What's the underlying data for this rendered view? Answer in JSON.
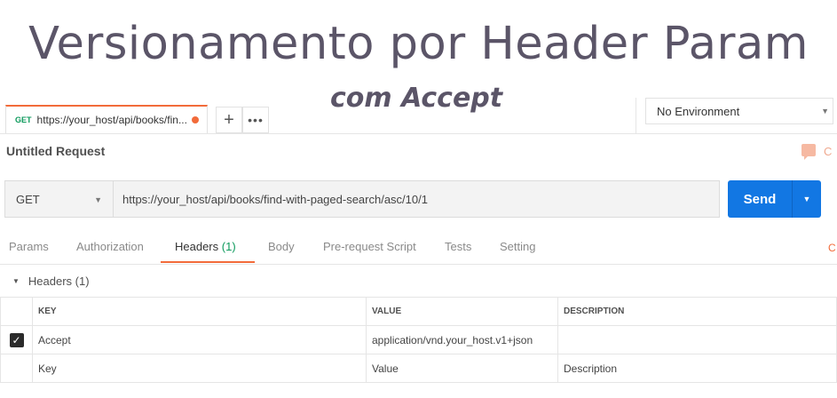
{
  "slide": {
    "title": "Versionamento por Header Param",
    "subtitle": "com Accept"
  },
  "tabbar": {
    "tab": {
      "method": "GET",
      "url": "https://your_host/api/books/fin..."
    },
    "add_label": "+",
    "more_label": "•••"
  },
  "environment": {
    "selected": "No Environment"
  },
  "request": {
    "title": "Untitled Request",
    "comments_label": "C",
    "method": "GET",
    "url": "https://your_host/api/books/find-with-paged-search/asc/10/1",
    "send_label": "Send"
  },
  "subtabs": {
    "params": "Params",
    "authorization": "Authorization",
    "headers": "Headers",
    "headers_count": "(1)",
    "body": "Body",
    "prerequest": "Pre-request Script",
    "tests": "Tests",
    "settings": "Setting",
    "edge": "C"
  },
  "headers_section": {
    "title": "Headers (1)",
    "columns": {
      "key": "KEY",
      "value": "VALUE",
      "description": "DESCRIPTION"
    },
    "rows": [
      {
        "checked": true,
        "key": "Accept",
        "value": "application/vnd.your_host.v1+json",
        "description": ""
      }
    ],
    "placeholder": {
      "key": "Key",
      "value": "Value",
      "description": "Description"
    }
  },
  "colors": {
    "accent_orange": "#f26b3a",
    "send_blue": "#1277e3",
    "method_green": "#0d9a5c",
    "title_color": "#5b5568"
  }
}
